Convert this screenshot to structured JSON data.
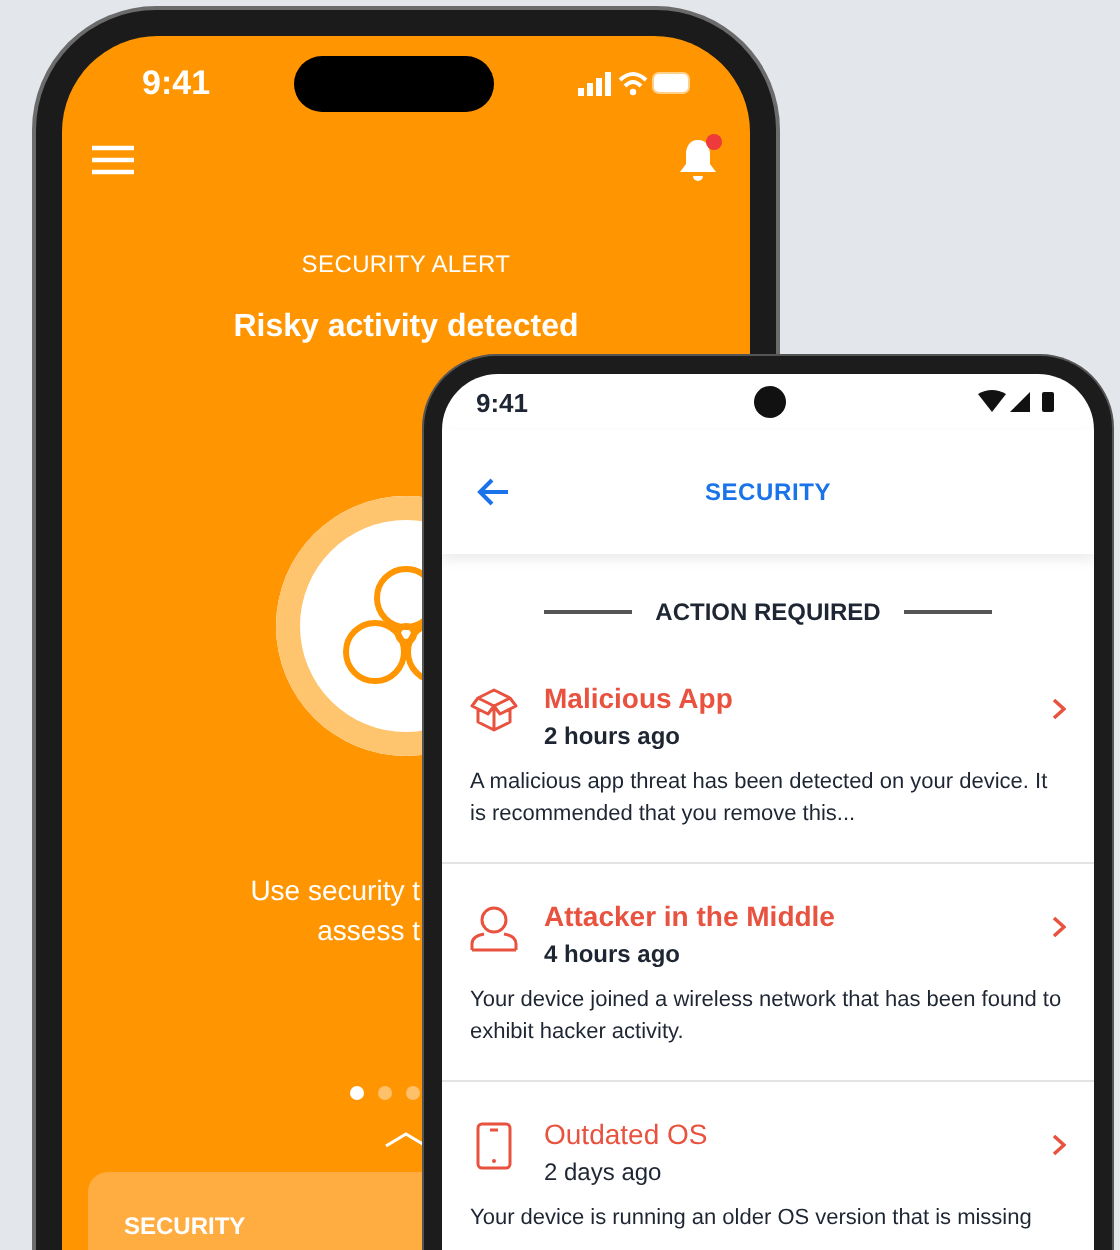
{
  "back_phone": {
    "status_bar": {
      "time": "9:41"
    },
    "header": {
      "notification_badge": true
    },
    "alert": {
      "label": "SECURITY ALERT",
      "title": "Risky activity detected",
      "description_lines": [
        "Use security t",
        "assess t"
      ]
    },
    "pager": [
      {
        "selected": true
      },
      {
        "selected": false
      },
      {
        "selected": false
      }
    ],
    "panel": {
      "title": "SECURITY"
    }
  },
  "front_phone": {
    "status_bar": {
      "time": "9:41"
    },
    "header": {
      "title": "SECURITY"
    },
    "section": {
      "title": "ACTION REQUIRED"
    },
    "alerts": [
      {
        "kind": "app",
        "title": "Malicious App",
        "time": "2 hours ago",
        "description": "A malicious app threat has been detected on your device. It is recommended that you remove this...",
        "unread": true
      },
      {
        "kind": "network",
        "title": "Attacker in the Middle",
        "time": "4 hours ago",
        "description": "Your device joined a wireless network that has been found to exhibit hacker activity.",
        "unread": true
      },
      {
        "kind": "os",
        "title": "Outdated OS",
        "time": "2 days ago",
        "description": "Your device is running an older OS version that is missing",
        "unread": false
      }
    ]
  }
}
